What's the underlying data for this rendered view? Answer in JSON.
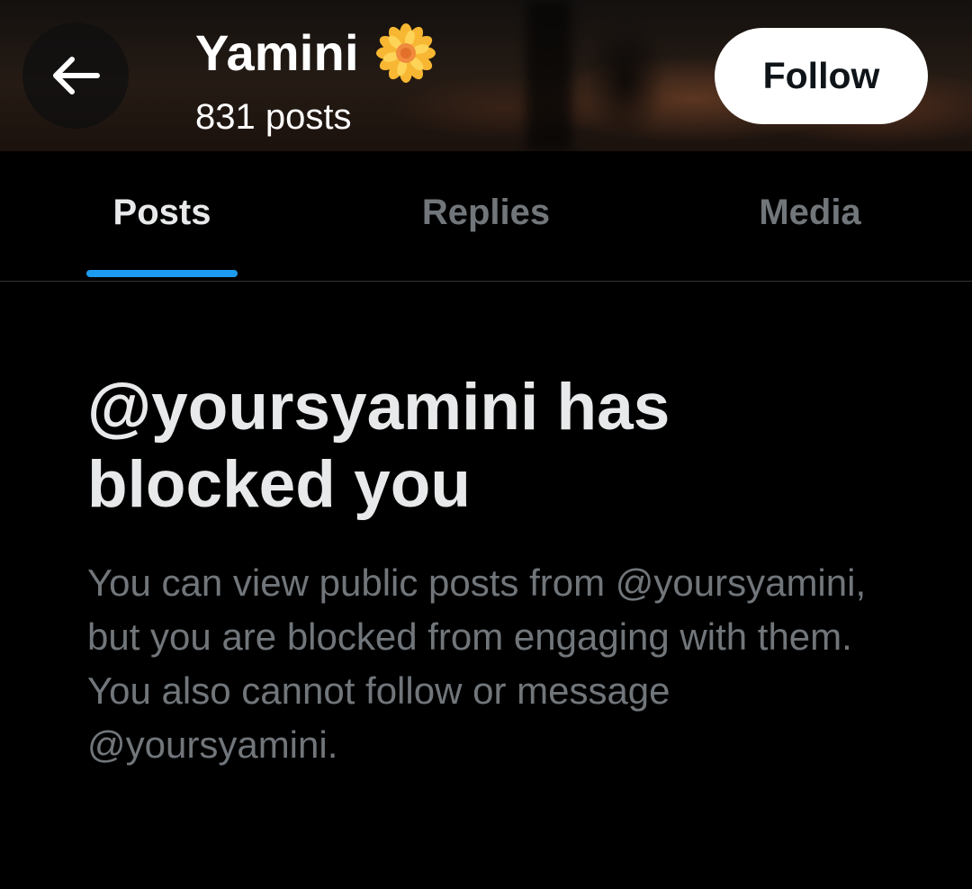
{
  "header": {
    "back_icon": "arrow-left-icon",
    "name": "Yamini",
    "name_emoji_icon": "flower-icon",
    "post_count": "831 posts",
    "follow_label": "Follow"
  },
  "tabs": [
    {
      "label": "Posts",
      "active": true
    },
    {
      "label": "Replies",
      "active": false
    },
    {
      "label": "Media",
      "active": false
    }
  ],
  "blocked": {
    "title": "@yoursyamini has blocked you",
    "body": "You can view public posts from @yoursyamini, but you are blocked from engaging with them. You also cannot follow or message @yoursyamini."
  },
  "colors": {
    "background": "#000000",
    "primary_text": "#e7e9ea",
    "secondary_text": "#71767b",
    "accent": "#1d9bf0",
    "divider": "#2f3336"
  }
}
